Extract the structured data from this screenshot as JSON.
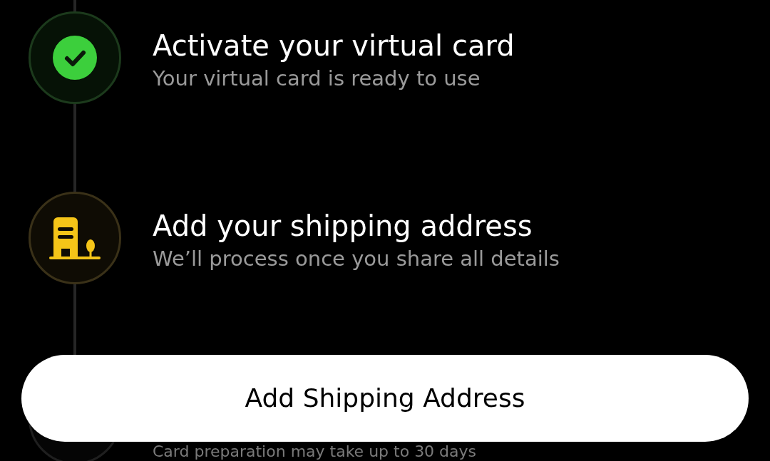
{
  "steps": [
    {
      "kind": "done",
      "title": "Activate your virtual card",
      "subtitle": "Your virtual card is ready to use"
    },
    {
      "kind": "current",
      "title": "Add your shipping address",
      "subtitle": "We’ll process once you share all details"
    },
    {
      "kind": "upcoming",
      "subtitle": "Card preparation may take up to 30 days"
    }
  ],
  "button": {
    "label": "Add Shipping Address"
  }
}
